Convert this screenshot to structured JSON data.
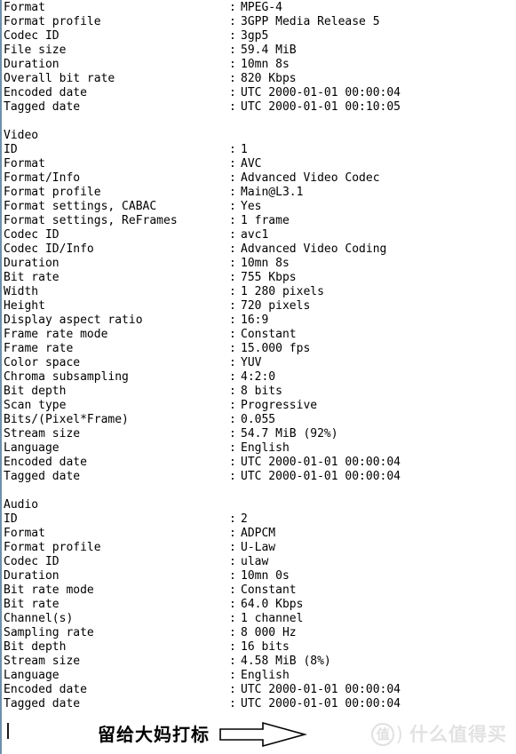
{
  "document": {
    "kind": "mediainfo-text-report",
    "colors": {
      "background": "#ffffff",
      "text": "#000000",
      "left_border": "#6f90ad",
      "watermark": "#e2e2e2"
    },
    "sections": [
      {
        "heading": "",
        "rows": [
          {
            "label": "Format",
            "sep": ":",
            "value": "MPEG-4"
          },
          {
            "label": "Format profile",
            "sep": ":",
            "value": "3GPP Media Release 5"
          },
          {
            "label": "Codec ID",
            "sep": ":",
            "value": "3gp5"
          },
          {
            "label": "File size",
            "sep": ":",
            "value": "59.4 MiB"
          },
          {
            "label": "Duration",
            "sep": ":",
            "value": "10mn 8s"
          },
          {
            "label": "Overall bit rate",
            "sep": ":",
            "value": "820 Kbps"
          },
          {
            "label": "Encoded date",
            "sep": ":",
            "value": "UTC 2000-01-01 00:00:04"
          },
          {
            "label": "Tagged date",
            "sep": ":",
            "value": "UTC 2000-01-01 00:10:05"
          }
        ]
      },
      {
        "heading": "Video",
        "rows": [
          {
            "label": "ID",
            "sep": ":",
            "value": "1"
          },
          {
            "label": "Format",
            "sep": ":",
            "value": "AVC"
          },
          {
            "label": "Format/Info",
            "sep": ":",
            "value": "Advanced Video Codec"
          },
          {
            "label": "Format profile",
            "sep": ":",
            "value": "Main@L3.1"
          },
          {
            "label": "Format settings, CABAC",
            "sep": ":",
            "value": "Yes"
          },
          {
            "label": "Format settings, ReFrames",
            "sep": ":",
            "value": "1 frame"
          },
          {
            "label": "Codec ID",
            "sep": ":",
            "value": "avc1"
          },
          {
            "label": "Codec ID/Info",
            "sep": ":",
            "value": "Advanced Video Coding"
          },
          {
            "label": "Duration",
            "sep": ":",
            "value": "10mn 8s"
          },
          {
            "label": "Bit rate",
            "sep": ":",
            "value": "755 Kbps"
          },
          {
            "label": "Width",
            "sep": ":",
            "value": "1 280 pixels"
          },
          {
            "label": "Height",
            "sep": ":",
            "value": "720 pixels"
          },
          {
            "label": "Display aspect ratio",
            "sep": ":",
            "value": "16:9"
          },
          {
            "label": "Frame rate mode",
            "sep": ":",
            "value": "Constant"
          },
          {
            "label": "Frame rate",
            "sep": ":",
            "value": "15.000 fps"
          },
          {
            "label": "Color space",
            "sep": ":",
            "value": "YUV"
          },
          {
            "label": "Chroma subsampling",
            "sep": ":",
            "value": "4:2:0"
          },
          {
            "label": "Bit depth",
            "sep": ":",
            "value": "8 bits"
          },
          {
            "label": "Scan type",
            "sep": ":",
            "value": "Progressive"
          },
          {
            "label": "Bits/(Pixel*Frame)",
            "sep": ":",
            "value": "0.055"
          },
          {
            "label": "Stream size",
            "sep": ":",
            "value": "54.7 MiB (92%)"
          },
          {
            "label": "Language",
            "sep": ":",
            "value": "English"
          },
          {
            "label": "Encoded date",
            "sep": ":",
            "value": "UTC 2000-01-01 00:00:04"
          },
          {
            "label": "Tagged date",
            "sep": ":",
            "value": "UTC 2000-01-01 00:00:04"
          }
        ]
      },
      {
        "heading": "Audio",
        "rows": [
          {
            "label": "ID",
            "sep": ":",
            "value": "2"
          },
          {
            "label": "Format",
            "sep": ":",
            "value": "ADPCM"
          },
          {
            "label": "Format profile",
            "sep": ":",
            "value": "U-Law"
          },
          {
            "label": "Codec ID",
            "sep": ":",
            "value": "ulaw"
          },
          {
            "label": "Duration",
            "sep": ":",
            "value": "10mn 0s"
          },
          {
            "label": "Bit rate mode",
            "sep": ":",
            "value": "Constant"
          },
          {
            "label": "Bit rate",
            "sep": ":",
            "value": "64.0 Kbps"
          },
          {
            "label": "Channel(s)",
            "sep": ":",
            "value": "1 channel"
          },
          {
            "label": "Sampling rate",
            "sep": ":",
            "value": "8 000 Hz"
          },
          {
            "label": "Bit depth",
            "sep": ":",
            "value": "16 bits"
          },
          {
            "label": "Stream size",
            "sep": ":",
            "value": "4.58 MiB (8%)"
          },
          {
            "label": "Language",
            "sep": ":",
            "value": "English"
          },
          {
            "label": "Encoded date",
            "sep": ":",
            "value": "UTC 2000-01-01 00:00:04"
          },
          {
            "label": "Tagged date",
            "sep": ":",
            "value": "UTC 2000-01-01 00:00:04"
          }
        ]
      }
    ]
  },
  "annotation": {
    "text": "留给大妈打标",
    "arrow_icon": "right-arrow-outline-icon"
  },
  "watermark": {
    "badge_char": "值",
    "paren": ")",
    "text": "什么值得买"
  }
}
